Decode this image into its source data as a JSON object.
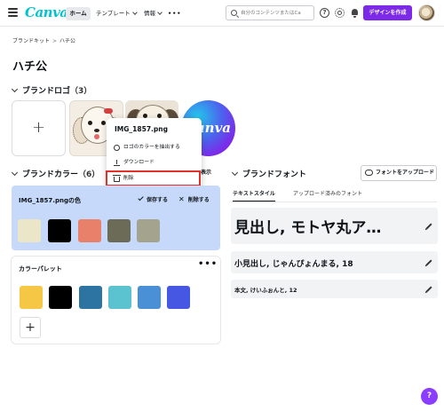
{
  "app": {
    "logo_text": "Canva"
  },
  "nav": {
    "home": "ホーム",
    "templates": "テンプレート",
    "info": "情報",
    "more": "•••"
  },
  "search": {
    "placeholder": "自分のコンテンツまたはCa"
  },
  "header_actions": {
    "help": "?",
    "create_button": "デザインを作成"
  },
  "breadcrumb": {
    "root": "ブランドキット",
    "separator": ">",
    "current": "ハチ公"
  },
  "page_title": "ハチ公",
  "brand_logos": {
    "heading": "ブランドロゴ",
    "count": "（3）",
    "add_label": "+",
    "canva_tile_text": "Canva"
  },
  "context_menu": {
    "title": "IMG_1857.png",
    "items": [
      {
        "label": "ロゴのカラーを抽出する",
        "icon": "palette-icon"
      },
      {
        "label": "ダウンロード",
        "icon": "download-icon"
      },
      {
        "label": "削除",
        "icon": "trash-icon"
      }
    ]
  },
  "brand_colors": {
    "heading": "ブランドカラー",
    "count": "（6）",
    "show_button": "表示",
    "extracted_card": {
      "title": "IMG_1857.pngの色",
      "save_label": "保存する",
      "delete_label": "削除する",
      "swatches": [
        "#ece6c9",
        "#000000",
        "#e8806a",
        "#6b6b58",
        "#a3a38e"
      ]
    },
    "palette_card": {
      "title": "カラーパレット",
      "more": "•••",
      "add_label": "+",
      "swatches": [
        "#f5c744",
        "#000000",
        "#2e74a2",
        "#5bc3cf",
        "#4a90d6",
        "#4557e3"
      ]
    }
  },
  "brand_fonts": {
    "heading": "ブランドフォント",
    "upload_button": "フォントをアップロード",
    "tabs": [
      "テキストスタイル",
      "アップロード済みのフォント"
    ],
    "styles": [
      {
        "label": "見出し, モトヤ丸ア…"
      },
      {
        "label": "小見出し, じゃんぴょんまる, 18"
      },
      {
        "label": "本文, けいふぉんと, 12"
      }
    ]
  },
  "help_fab": "?"
}
